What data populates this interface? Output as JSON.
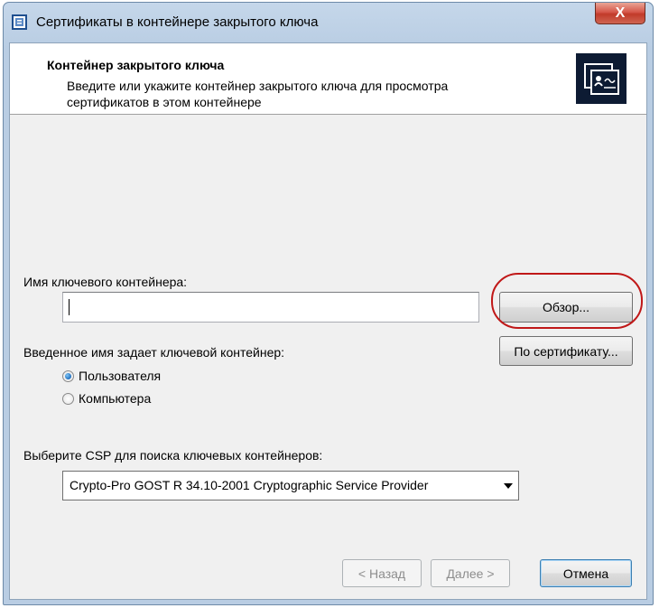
{
  "window": {
    "title": "Сертификаты в контейнере закрытого ключа",
    "close_label": "X"
  },
  "header": {
    "title": "Контейнер закрытого ключа",
    "description": "Введите или укажите контейнер закрытого ключа для просмотра сертификатов в этом контейнере",
    "icon": "certificate-icon"
  },
  "form": {
    "container_label": "Имя ключевого контейнера:",
    "container_value": "",
    "browse_label": "Обзор...",
    "by_cert_label": "По сертификату...",
    "scope_label": "Введенное имя задает ключевой контейнер:",
    "scope_options": [
      {
        "label": "Пользователя",
        "selected": true
      },
      {
        "label": "Компьютера",
        "selected": false
      }
    ],
    "csp_label": "Выберите CSP для поиска ключевых контейнеров:",
    "csp_value": "Crypto-Pro GOST R 34.10-2001 Cryptographic Service Provider"
  },
  "footer": {
    "back_label": "< Назад",
    "next_label": "Далее >",
    "cancel_label": "Отмена"
  },
  "colors": {
    "window_frame": "#b9cde3",
    "highlight": "#c01818",
    "close_button": "#c13a2a"
  }
}
